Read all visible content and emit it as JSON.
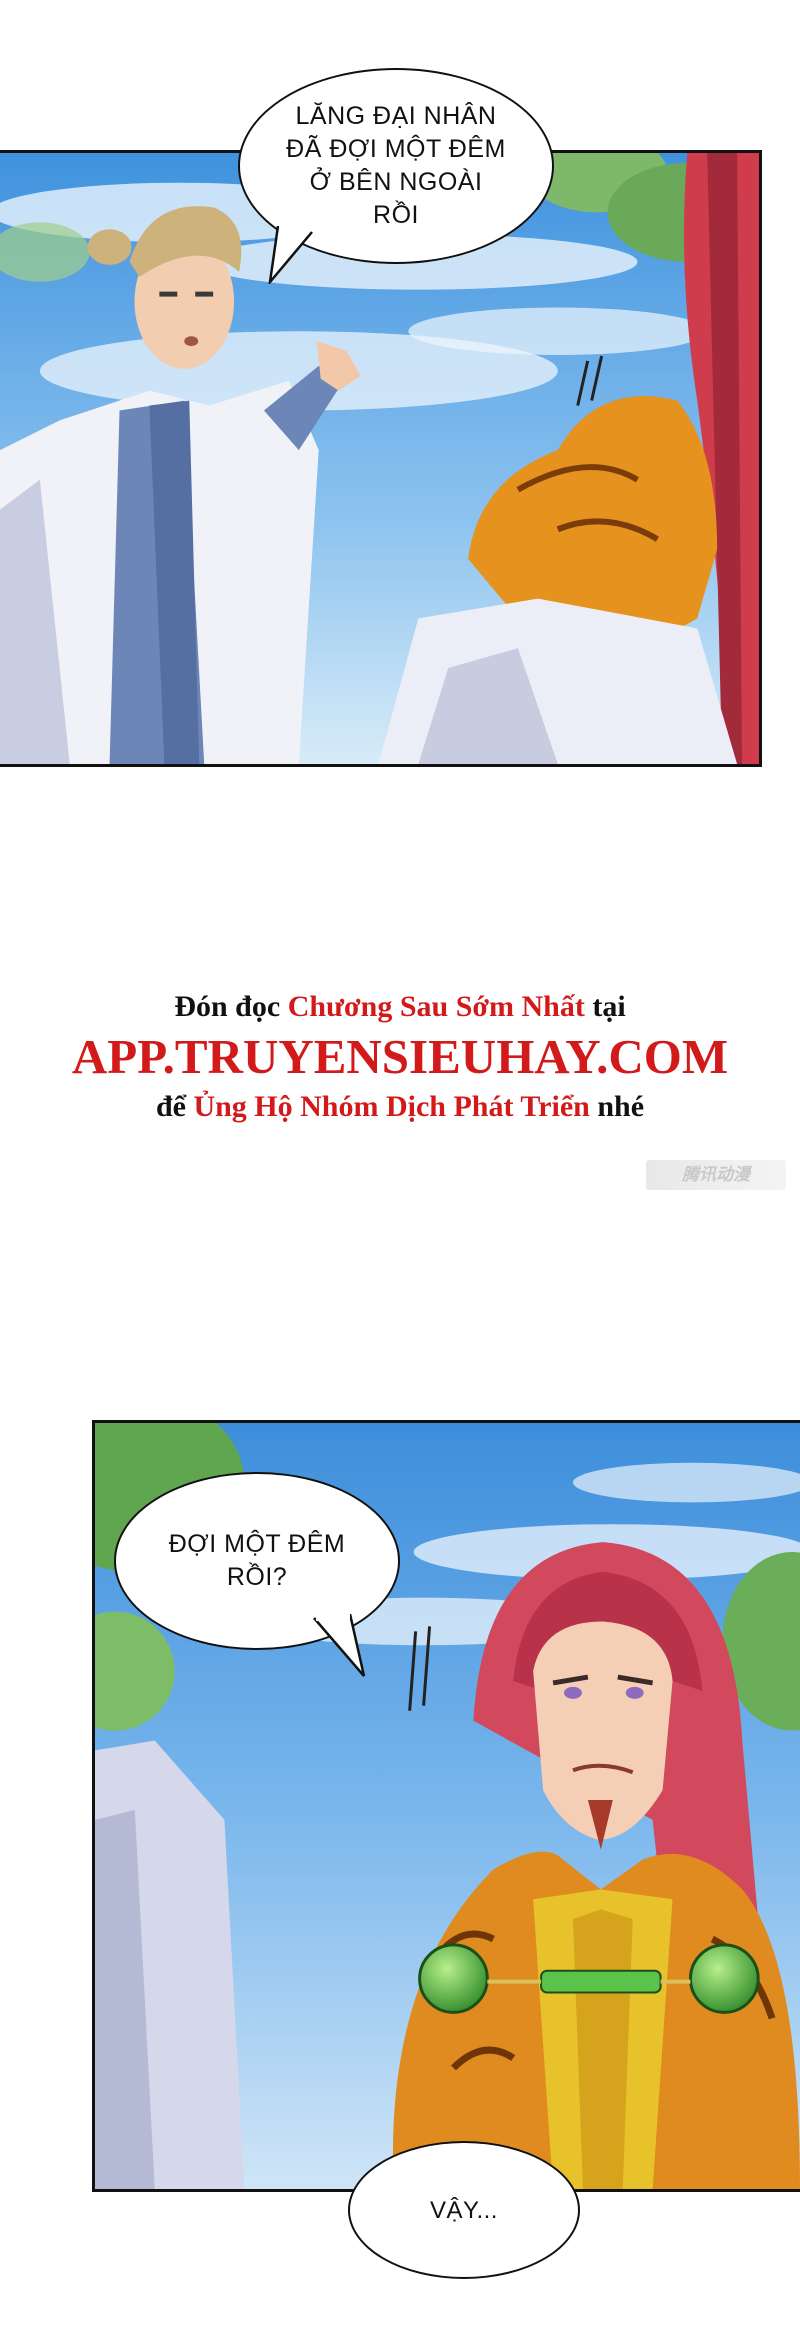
{
  "panel_top": {
    "speech_bubble": "LĂNG ĐẠI NHÂN\nĐÃ ĐỢI MỘT ĐÊM\nỞ BÊN NGOÀI\nRỒI"
  },
  "promo": {
    "line1_part1": "Đón đọc ",
    "line1_highlight": "Chương Sau Sớm Nhất",
    "line1_part2": " tại",
    "line2": "APP.TRUYENSIEUHAY.COM",
    "line3_part1": "để ",
    "line3_highlight": "Ủng Hộ Nhóm Dịch Phát Triển",
    "line3_part2": " nhé",
    "color_dark": "#111111",
    "color_red": "#d21a1a"
  },
  "watermark": "腾讯动漫",
  "panel_bottom": {
    "speech_bubble": "ĐỢI MỘT ĐÊM\nRỒI?",
    "caption_bubble": "VẬY..."
  },
  "colors": {
    "sky": "#5aa6e6",
    "panel_border": "#111111"
  }
}
